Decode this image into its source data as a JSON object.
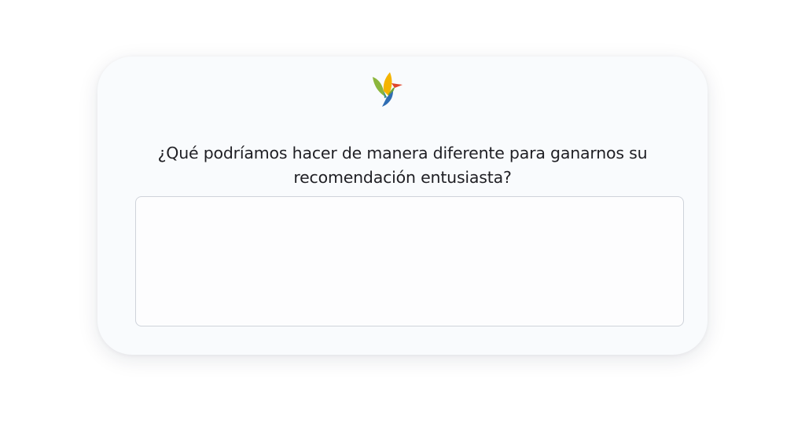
{
  "survey": {
    "logo_icon": "hummingbird-logo-icon",
    "question_line1": "¿Qué podríamos hacer de manera diferente para ganarnos su",
    "question_line2": "recomendación entusiasta?",
    "answer_value": "",
    "answer_placeholder": ""
  },
  "colors": {
    "card_background": "#f9fbfd",
    "field_border": "#cfd3da",
    "text": "#1f1f24",
    "logo_yellow": "#f4b400",
    "logo_green": "#8cb63c",
    "logo_blue": "#2f6db3",
    "logo_red": "#e0452b"
  }
}
